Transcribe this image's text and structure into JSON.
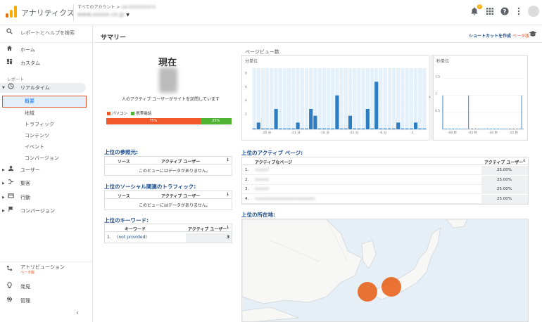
{
  "topbar": {
    "app_name": "アナリティクス",
    "breadcrumb_prefix": "すべてのアカウント >",
    "breadcrumb_account": "UA-XXXXXXXX-X",
    "property_name": "www.xxxxx.co.jp",
    "notification_count": "2",
    "icons": [
      "bell-icon",
      "apps-icon",
      "help-icon",
      "more-vert-icon"
    ]
  },
  "sidebar": {
    "search_label": "レポートとヘルプを検索",
    "items": {
      "home": "ホーム",
      "custom": "カスタム",
      "reports_section": "レポート",
      "realtime": "リアルタイム",
      "audience": "ユーザー",
      "acquisition": "集客",
      "behavior": "行動",
      "conversions": "コンバージョン",
      "attribution": "アトリビューション",
      "attribution_badge": "ベータ版",
      "discover": "発見",
      "admin": "管理"
    },
    "realtime_sub": [
      "概要",
      "地域",
      "トラフィック",
      "コンテンツ",
      "イベント",
      "コンバージョン"
    ],
    "collapse_icon": "chevron-left-icon"
  },
  "summary": {
    "title": "サマリー",
    "shortcut_label": "ショートカットを作成",
    "shortcut_badge": "ベータ版",
    "now_label": "現在",
    "active_users_text": "人のアクティブ ユーザーがサイトを訪問しています",
    "legend": [
      {
        "label": "パソコン",
        "color": "#f1592a"
      },
      {
        "label": "携帯電話",
        "color": "#50b432"
      }
    ],
    "device_split": [
      {
        "label": "75%",
        "value": 0.75,
        "color": "#f1592a"
      },
      {
        "label": "25%",
        "value": 0.25,
        "color": "#50b432"
      }
    ]
  },
  "referrals": {
    "title": "上位の参照元:",
    "col1": "ソース",
    "col2": "アクティブ ユーザー",
    "empty": "このビューにはデータがありません。"
  },
  "social": {
    "title": "上位のソーシャル関連のトラフィック:",
    "col1": "ソース",
    "col2": "アクティブ ユーザー",
    "empty": "このビューにはデータがありません。"
  },
  "keywords": {
    "title": "上位のキーワード:",
    "col1": "キーワード",
    "col2": "アクティブ ユーザー",
    "rows": [
      {
        "idx": "1.",
        "keyword": "(not provided)",
        "users": "3"
      }
    ]
  },
  "pageviews": {
    "title": "ページビュー数",
    "per_minute_label": "分単位",
    "per_second_label": "秒単位",
    "min_y_ticks": [
      "8",
      "6",
      "4",
      "2"
    ],
    "min_x_ticks": [
      "-26 分",
      "-21 分",
      "-16 分",
      "-11 分",
      "-6 分",
      "-1"
    ],
    "min_values": [
      0,
      1,
      0,
      0,
      0,
      3,
      0,
      0,
      0,
      0,
      1,
      0,
      0,
      3,
      2,
      0,
      0,
      0,
      0,
      5,
      0,
      0,
      2,
      0,
      0,
      0,
      3,
      0,
      7,
      0,
      0,
      0,
      0,
      1,
      0,
      0,
      0,
      1,
      0,
      0
    ],
    "sec_y_ticks": [
      "1.5",
      "1",
      "0.5"
    ],
    "sec_x_ticks": [
      "-60 秒",
      "-45 秒",
      "-30 秒",
      "-15 秒"
    ],
    "sec_values": [
      1,
      0,
      0,
      0,
      0,
      0,
      0,
      0,
      0,
      0,
      0,
      0,
      0,
      0,
      0,
      0,
      0,
      0,
      0,
      1,
      0,
      0,
      0,
      0,
      0,
      0,
      0,
      0,
      0,
      0,
      0,
      0,
      0,
      0,
      0,
      0,
      0,
      0,
      0,
      0,
      0,
      0,
      0,
      0,
      0,
      0,
      0,
      0,
      0,
      0,
      0,
      0,
      0,
      0,
      0,
      0,
      0,
      0,
      1,
      0
    ]
  },
  "pages": {
    "title": "上位のアクティブ ページ:",
    "col1": "アクティブなページ",
    "col2": "アクティブ ユーザー",
    "rows": [
      {
        "idx": "1.",
        "page": "/xxxxx/",
        "pct": "25.00%"
      },
      {
        "idx": "2.",
        "page": "/xxxxx/",
        "pct": "25.00%"
      },
      {
        "idx": "3.",
        "page": "/xxxxx/",
        "pct": "25.00%"
      },
      {
        "idx": "4.",
        "page": "/xxxxx/xxxxxxxxxx/xxxxxxxxx/",
        "pct": "25.00%"
      }
    ]
  },
  "location": {
    "title": "上位の所在地:"
  }
}
